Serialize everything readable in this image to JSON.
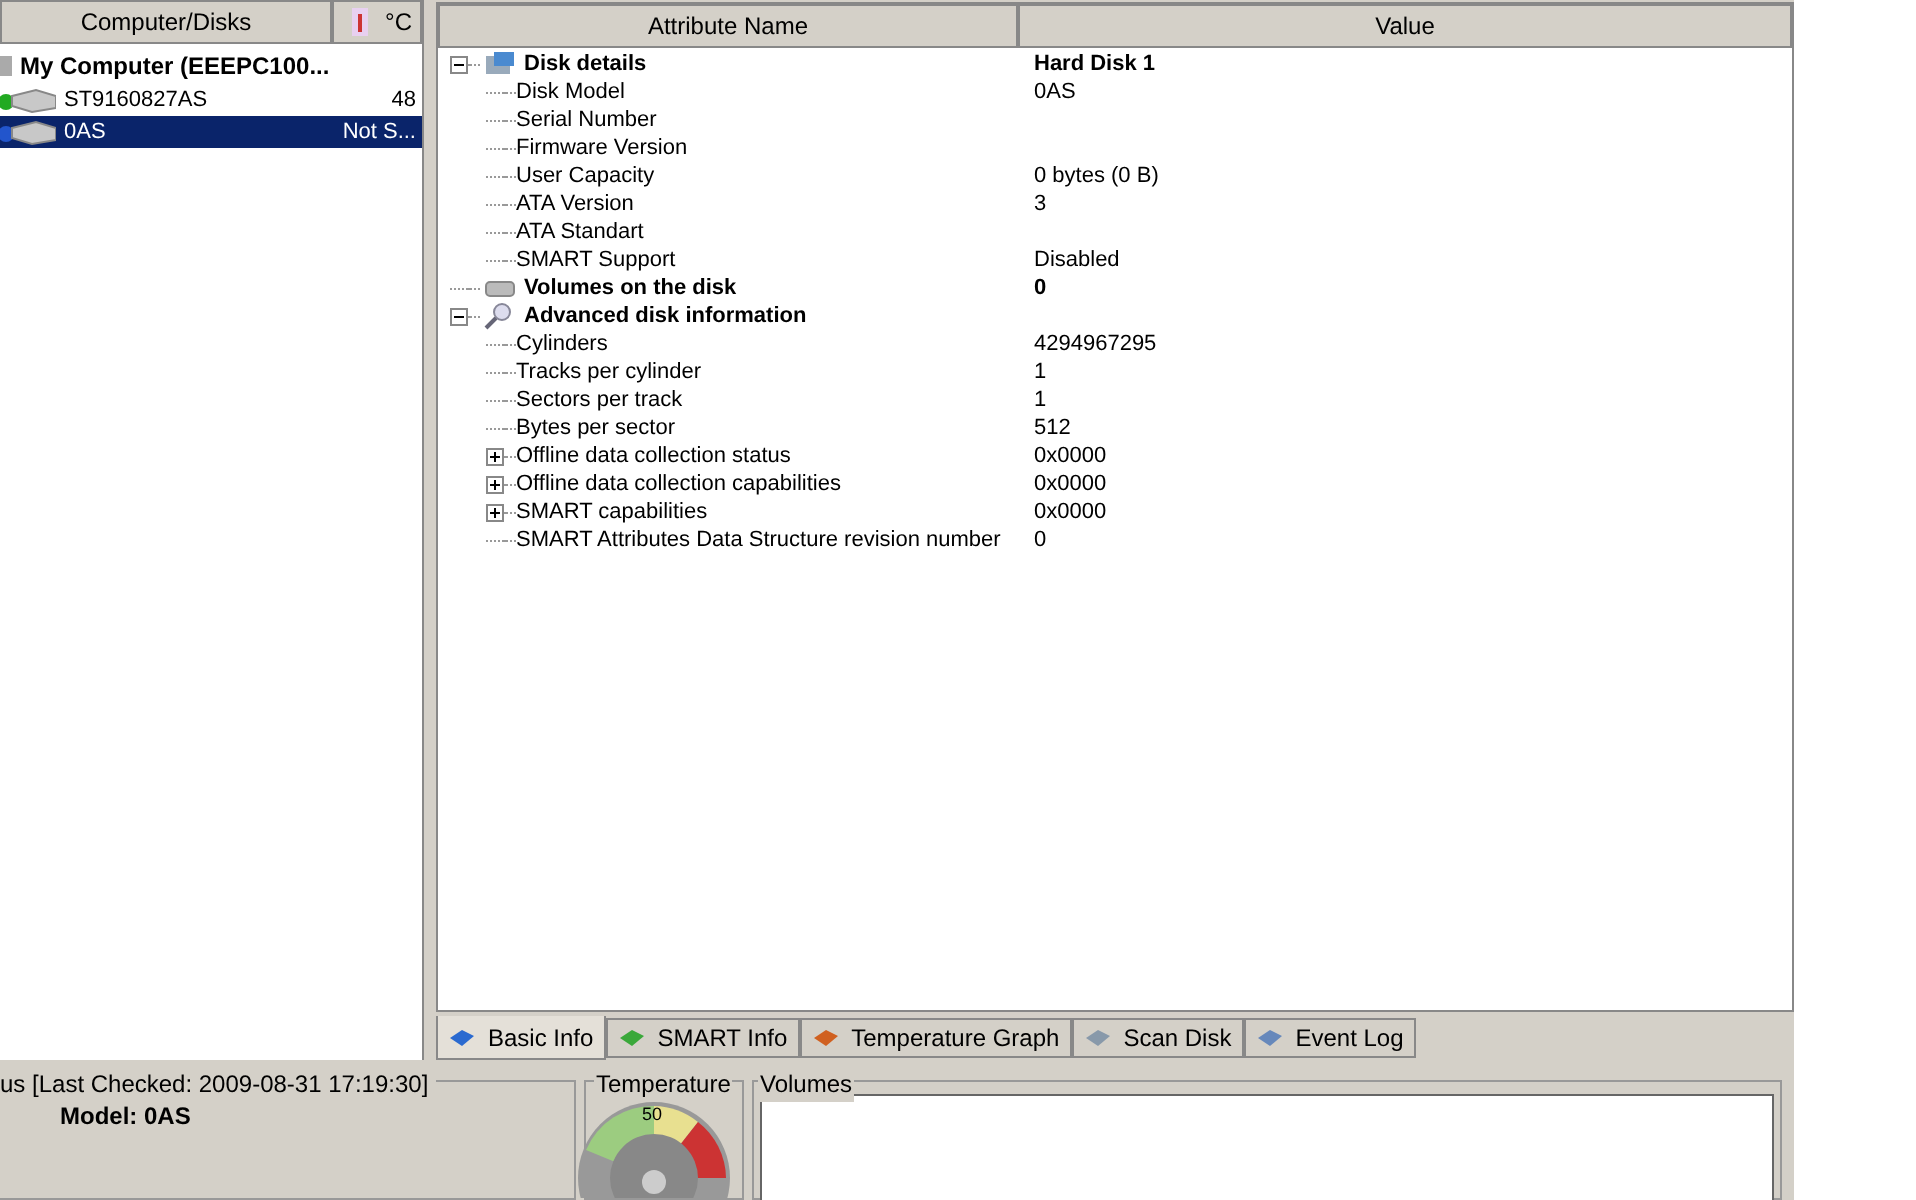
{
  "disks_panel": {
    "columns": [
      "Computer/Disks",
      "°C"
    ],
    "computer": "My Computer (EEEPC100...",
    "disks": [
      {
        "name": "ST9160827AS",
        "temp": "48",
        "selected": false,
        "color": "#22aa22"
      },
      {
        "name": "0AS",
        "temp": "Not S...",
        "selected": true,
        "color": "#2255cc"
      }
    ]
  },
  "attributes": {
    "columns": [
      "Attribute Name",
      "Value"
    ],
    "groups": [
      {
        "name": "Disk details",
        "value": "Hard Disk 1",
        "expanded": true,
        "children": [
          {
            "name": "Disk Model",
            "value": "0AS"
          },
          {
            "name": "Serial Number"
          },
          {
            "name": "Firmware Version"
          },
          {
            "name": "User Capacity",
            "value": "0 bytes (0 B)"
          },
          {
            "name": "ATA Version",
            "value": "3"
          },
          {
            "name": "ATA Standart"
          },
          {
            "name": "SMART Support",
            "value": "Disabled"
          }
        ]
      },
      {
        "name": "Volumes on the disk",
        "value": "0"
      },
      {
        "name": "Advanced disk information",
        "expanded": true,
        "children": [
          {
            "name": "Cylinders",
            "value": "4294967295"
          },
          {
            "name": "Tracks per cylinder",
            "value": "1"
          },
          {
            "name": "Sectors per track",
            "value": "1"
          },
          {
            "name": "Bytes per sector",
            "value": "512"
          },
          {
            "name": "Offline data collection status",
            "value": "0x0000",
            "expanded": false
          },
          {
            "name": "Offline data collection capabilities",
            "value": "0x0000",
            "expanded": false
          },
          {
            "name": "SMART capabilities",
            "value": "0x0000",
            "expanded": false
          },
          {
            "name": "SMART Attributes Data Structure revision number",
            "value": "0"
          }
        ]
      }
    ]
  },
  "tabs": [
    {
      "label": "Basic Info",
      "selected": true
    },
    {
      "label": "SMART Info",
      "selected": false
    },
    {
      "label": "Temperature Graph",
      "selected": false
    },
    {
      "label": "Scan Disk",
      "selected": false
    },
    {
      "label": "Event Log",
      "selected": false
    }
  ],
  "status": {
    "title": "us [Last Checked: 2009-08-31 17:19:30]",
    "model": "Model: 0AS"
  },
  "temperature": {
    "title": "Temperature",
    "gauge_label": "50"
  },
  "volumes": {
    "title": "Volumes"
  }
}
